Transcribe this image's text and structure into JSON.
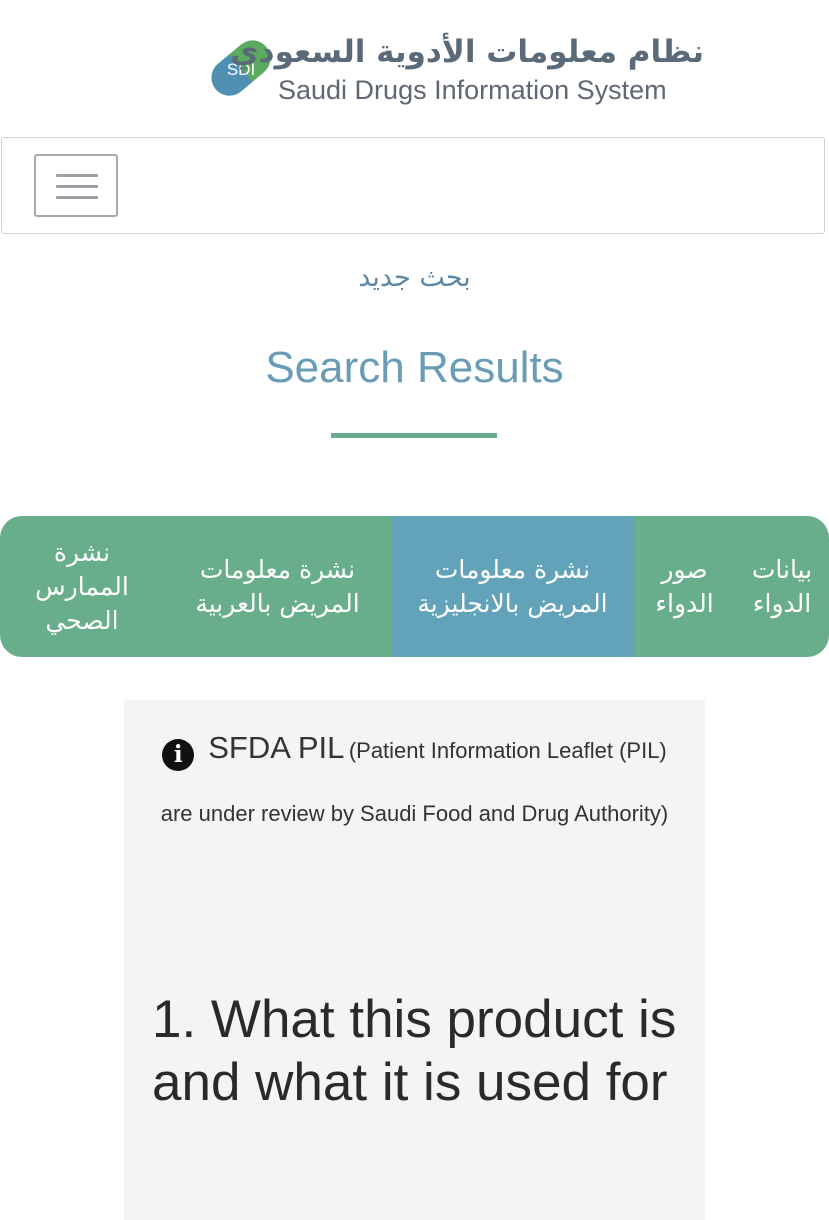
{
  "header": {
    "logo_badge": "SDI",
    "logo_title_ar": "نظام معلومات الأدوية السعودي",
    "logo_title_en": "Saudi Drugs Information System",
    "logo_green": "#5aab5f",
    "logo_blue": "#4e8fb2"
  },
  "navbar": {
    "menu_icon": "hamburger-icon"
  },
  "main": {
    "new_search": "بحث جديد",
    "title": "Search Results",
    "accent_color": "#6aab8e"
  },
  "tabs": [
    {
      "line1": "بيانات",
      "line2": "الدواء",
      "active": false
    },
    {
      "line1": "صور",
      "line2": "الدواء",
      "active": false
    },
    {
      "line1": "نشرة معلومات",
      "line2": "المريض بالانجليزية",
      "active": true
    },
    {
      "line1": "نشرة معلومات",
      "line2": "المريض بالعربية",
      "active": false
    },
    {
      "line1": "نشرة",
      "line2": "الممارس",
      "line3": "الصحي",
      "active": false
    }
  ],
  "tab_colors": {
    "normal": "#68ae8a",
    "active": "#62a3b9"
  },
  "card": {
    "info_icon": "info-icon",
    "notice_lead": "SFDA PIL",
    "notice_text": "(Patient Information Leaflet (PIL) are under review by Saudi Food and Drug Authority)",
    "section_heading": "1. What this product is and what it is used for"
  }
}
